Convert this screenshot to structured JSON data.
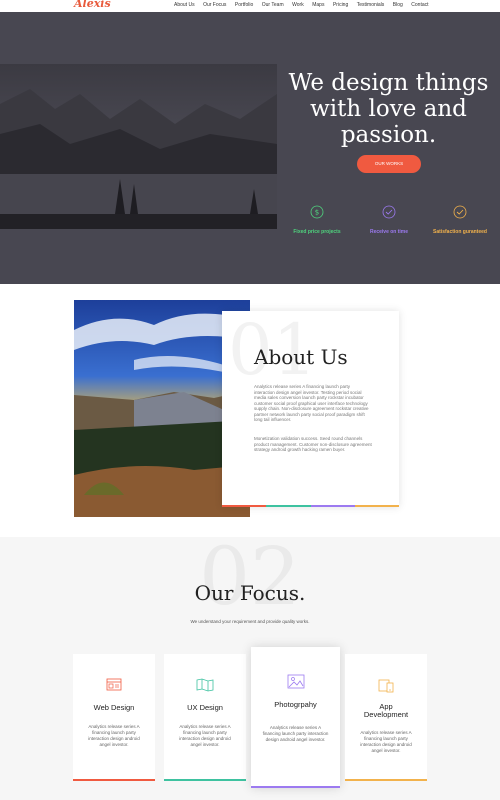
{
  "nav": {
    "logo": "Alexis",
    "items": [
      "About Us",
      "Our Focus",
      "Portfolio",
      "Our Team",
      "Work",
      "Maps",
      "Pricing",
      "Testimonials",
      "Blog",
      "Contact"
    ]
  },
  "hero": {
    "title": "We design things with love and passion.",
    "button": "OUR WORKS",
    "features": [
      {
        "label": "Fixed price projects",
        "icon": "dollar-icon",
        "color": "#4fd47e"
      },
      {
        "label": "Receive on time",
        "icon": "check-circle-icon",
        "color": "#9c7af0"
      },
      {
        "label": "Satisfaction guranteed",
        "icon": "check-circle-icon",
        "color": "#f2b24c"
      }
    ]
  },
  "about": {
    "number": "01",
    "title": "About Us",
    "p1": "Analytics release series A financing launch party interaction design angel investor. Testing period social media sales conversion launch party rockstar incubator customer social proof graphical user interface technology supply chain. Non-disclosure agreement rockstar creative partner network launch party social proof paradigm shift long tail influencer.",
    "p2": "Monetization validation success. Seed round channels product management. Customer non-disclosure agreement strategy android growth hacking ramen buyer."
  },
  "focus": {
    "number": "02",
    "title": "Our Focus.",
    "subtitle": "We understand your requirement and provide quality works.",
    "cards": [
      {
        "title": "Web Design",
        "desc": "Analytics release series A financing launch party interaction design android angel investor.",
        "icon": "web-design-icon",
        "color": "#f05a40"
      },
      {
        "title": "UX Design",
        "desc": "Analytics release series A financing launch party interaction design android angel investor.",
        "icon": "map-icon",
        "color": "#3ec2a0"
      },
      {
        "title": "Photogrpahy",
        "desc": "Analytics release series A financing launch party interaction design android angel investor.",
        "icon": "photo-icon",
        "color": "#9c7af0"
      },
      {
        "title": "App Development",
        "desc": "Analytics release series A financing launch party interaction design android angel investor.",
        "icon": "devices-icon",
        "color": "#f2b24c"
      }
    ]
  },
  "colors": {
    "accent": "#f05a40",
    "hero_bg": "#484751"
  }
}
